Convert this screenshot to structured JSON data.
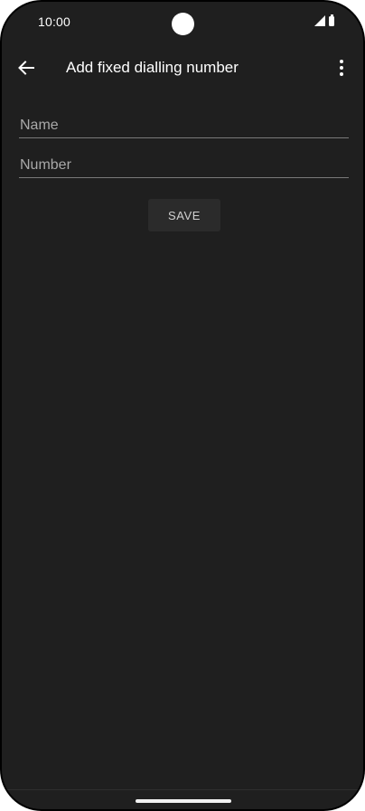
{
  "status_bar": {
    "time": "10:00",
    "icons": [
      "camera-cutout",
      "signal-icon",
      "battery-icon"
    ]
  },
  "app_bar": {
    "title": "Add fixed dialling number",
    "back_icon": "arrow-back-icon",
    "menu_icon": "more-vert-icon"
  },
  "form": {
    "name_placeholder": "Name",
    "number_placeholder": "Number",
    "save_label": "SAVE"
  },
  "colors": {
    "background": "#1f1f1f",
    "text_primary": "#ffffff",
    "placeholder": "#a9a9a9",
    "button_bg": "#2b2b2b"
  }
}
